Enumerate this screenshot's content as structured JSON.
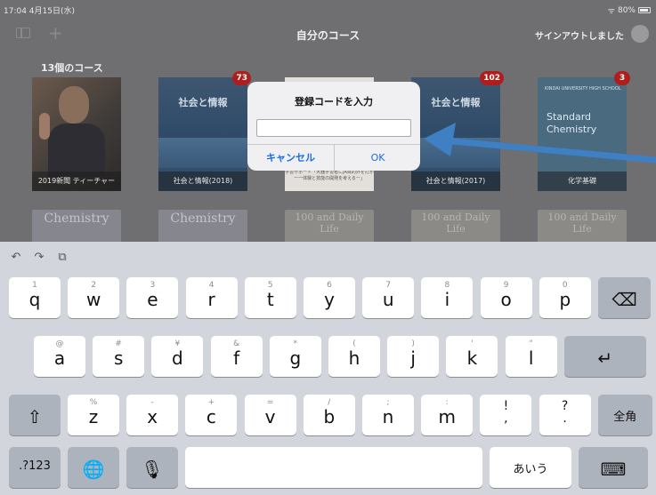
{
  "status_bar": {
    "time_date": "17:04  4月15日(水)",
    "battery": "80%"
  },
  "nav": {
    "title": "自分のコース",
    "signout": "サインアウトしました"
  },
  "library": {
    "count_label": "13個のコース",
    "books": [
      {
        "caption": "2019新聞 ティーチャー",
        "badge": ""
      },
      {
        "caption": "社会と情報(2018)",
        "badge": "73",
        "cover_title": "社会と情報"
      },
      {
        "caption": "",
        "badge": "",
        "cover_lines": "学習サポート「大器学習者にJA目的外を打がー一体験と技能の開発を考えるー」"
      },
      {
        "caption": "社会と情報(2017)",
        "badge": "102",
        "cover_title": "社会と情報"
      },
      {
        "caption": "化学基礎",
        "badge": "3",
        "cover_logo": "KINDAI UNIVERSITY HIGH SCHOOL",
        "cover_title": "Standard\nChemistry"
      }
    ],
    "row2": [
      "Chemistry",
      "Chemistry",
      "100 and Daily Life",
      "100 and Daily Life",
      "100 and Daily Life"
    ]
  },
  "dialog": {
    "title": "登録コードを入力",
    "input_value": "",
    "cancel_label": "キャンセル",
    "ok_label": "OK"
  },
  "keyboard": {
    "row1": [
      {
        "k": "q",
        "s": "1"
      },
      {
        "k": "w",
        "s": "2"
      },
      {
        "k": "e",
        "s": "3"
      },
      {
        "k": "r",
        "s": "4"
      },
      {
        "k": "t",
        "s": "5"
      },
      {
        "k": "y",
        "s": "6"
      },
      {
        "k": "u",
        "s": "7"
      },
      {
        "k": "i",
        "s": "8"
      },
      {
        "k": "o",
        "s": "9"
      },
      {
        "k": "p",
        "s": "0"
      }
    ],
    "row2": [
      {
        "k": "a",
        "s": "@"
      },
      {
        "k": "s",
        "s": "#"
      },
      {
        "k": "d",
        "s": "¥"
      },
      {
        "k": "f",
        "s": "&"
      },
      {
        "k": "g",
        "s": "*"
      },
      {
        "k": "h",
        "s": "("
      },
      {
        "k": "j",
        "s": ")"
      },
      {
        "k": "k",
        "s": "'"
      },
      {
        "k": "l",
        "s": "\""
      }
    ],
    "row3": [
      {
        "k": "z",
        "s": "%"
      },
      {
        "k": "x",
        "s": "-"
      },
      {
        "k": "c",
        "s": "+"
      },
      {
        "k": "v",
        "s": "="
      },
      {
        "k": "b",
        "s": "/"
      },
      {
        "k": "n",
        "s": ";"
      },
      {
        "k": "m",
        "s": ":"
      }
    ],
    "punct1": "!\n,",
    "punct2": "?\n.",
    "zenkaku": "全角",
    "numbers": ".?123",
    "kana": "あいう"
  },
  "colors": {
    "accent": "#1a6ee0",
    "badge": "#b01d1d",
    "arrow": "#3f7fc4"
  }
}
